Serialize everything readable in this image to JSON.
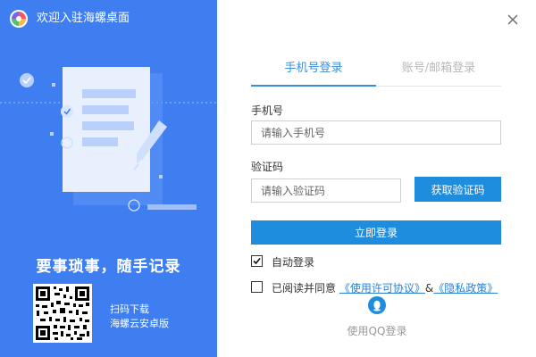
{
  "app": {
    "title": "欢迎入驻海螺桌面",
    "logo_icon": "snail-logo-icon"
  },
  "left_panel": {
    "background": "#3f7ef1",
    "slogan": "要事琐事，随手记录",
    "qr_line1": "扫码下载",
    "qr_line2": "海螺云安卓版"
  },
  "tabs": [
    {
      "label": "手机号登录",
      "active": true
    },
    {
      "label": "账号/邮箱登录",
      "active": false
    }
  ],
  "form": {
    "phone_label": "手机号",
    "phone_placeholder": "请输入手机号",
    "phone_value": "",
    "code_label": "验证码",
    "code_placeholder": "请输入验证码",
    "code_value": "",
    "get_code_button": "获取验证码",
    "login_button": "立即登录"
  },
  "options": {
    "auto_login_label": "自动登录",
    "auto_login_checked": true,
    "agree_checked": false,
    "agree_prefix": "已阅读并同意",
    "license_link": "《使用许可协议》",
    "ampersand": "&",
    "privacy_link": "《隐私政策》"
  },
  "qq": {
    "label": "使用QQ登录",
    "icon": "qq-penguin-icon"
  },
  "colors": {
    "accent": "#1f8ddd",
    "tab_active": "#3b8fd6",
    "link": "#2b82d4"
  }
}
